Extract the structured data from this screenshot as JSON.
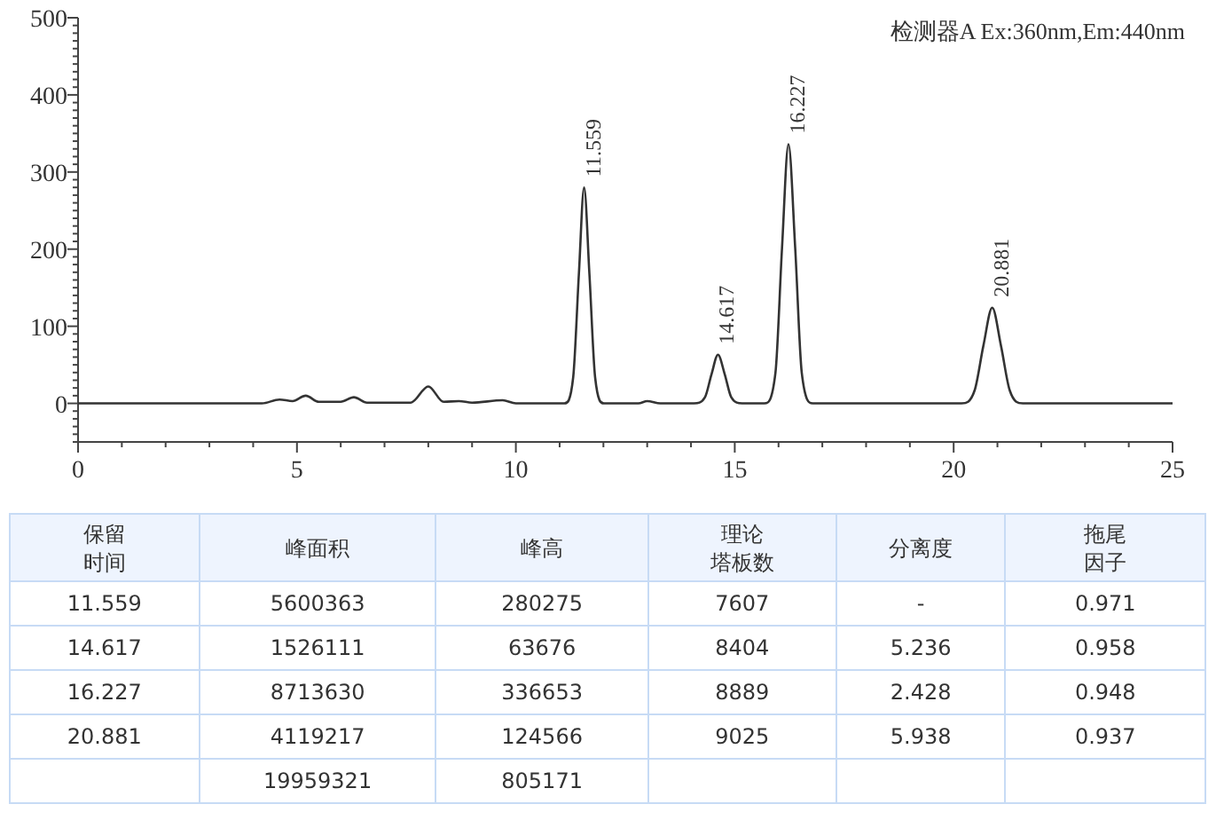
{
  "chromatogram": {
    "chart_data": {
      "type": "line",
      "title": "检测器A Ex:360nm,Em:440nm",
      "xlim": [
        0,
        25
      ],
      "ylim": [
        -50,
        500
      ],
      "xticks": [
        0,
        5,
        10,
        15,
        20,
        25
      ],
      "yticks": [
        0,
        100,
        200,
        300,
        400,
        500
      ],
      "x": [
        0,
        2.8,
        4.2,
        4.6,
        4.9,
        5.2,
        5.5,
        6.0,
        6.3,
        6.6,
        7.6,
        8.0,
        8.35,
        8.7,
        9.0,
        9.7,
        10.0,
        11.11,
        11.31,
        11.44,
        11.559,
        11.68,
        11.81,
        12.01,
        12.8,
        13.0,
        13.3,
        14.07,
        14.32,
        14.47,
        14.617,
        14.77,
        14.92,
        15.17,
        15.68,
        15.93,
        16.08,
        16.227,
        16.38,
        16.53,
        16.78,
        20.18,
        20.48,
        20.68,
        20.881,
        21.08,
        21.28,
        21.58,
        25
      ],
      "series": [
        {
          "color": "#333333",
          "values": [
            0,
            0,
            0,
            5,
            3,
            10,
            2,
            2,
            8,
            1,
            1,
            22,
            2,
            3,
            1,
            4,
            0,
            0,
            34,
            168,
            280,
            168,
            34,
            0,
            0,
            3,
            0,
            0,
            8,
            38,
            63,
            38,
            8,
            0,
            0,
            40,
            202,
            336,
            202,
            40,
            0,
            0,
            17,
            75,
            124,
            75,
            17,
            0,
            0
          ]
        }
      ],
      "annotations": [
        {
          "x": 11.559,
          "y": 280,
          "text": "11.559"
        },
        {
          "x": 14.617,
          "y": 63,
          "text": "14.617"
        },
        {
          "x": 16.227,
          "y": 336,
          "text": "16.227"
        },
        {
          "x": 20.881,
          "y": 124,
          "text": "20.881"
        }
      ]
    }
  },
  "table": {
    "columns": [
      {
        "lines": [
          "保留",
          "时间"
        ]
      },
      {
        "lines": [
          "峰面积"
        ]
      },
      {
        "lines": [
          "峰高"
        ]
      },
      {
        "lines": [
          "理论",
          "塔板数"
        ]
      },
      {
        "lines": [
          "分离度"
        ]
      },
      {
        "lines": [
          "拖尾",
          "因子"
        ]
      }
    ],
    "rows": [
      [
        "11.559",
        "5600363",
        "280275",
        "7607",
        "-",
        "0.971"
      ],
      [
        "14.617",
        "1526111",
        "63676",
        "8404",
        "5.236",
        "0.958"
      ],
      [
        "16.227",
        "8713630",
        "336653",
        "8889",
        "2.428",
        "0.948"
      ],
      [
        "20.881",
        "4119217",
        "124566",
        "9025",
        "5.938",
        "0.937"
      ],
      [
        null,
        "19959321",
        "805171",
        null,
        null,
        null
      ]
    ]
  }
}
